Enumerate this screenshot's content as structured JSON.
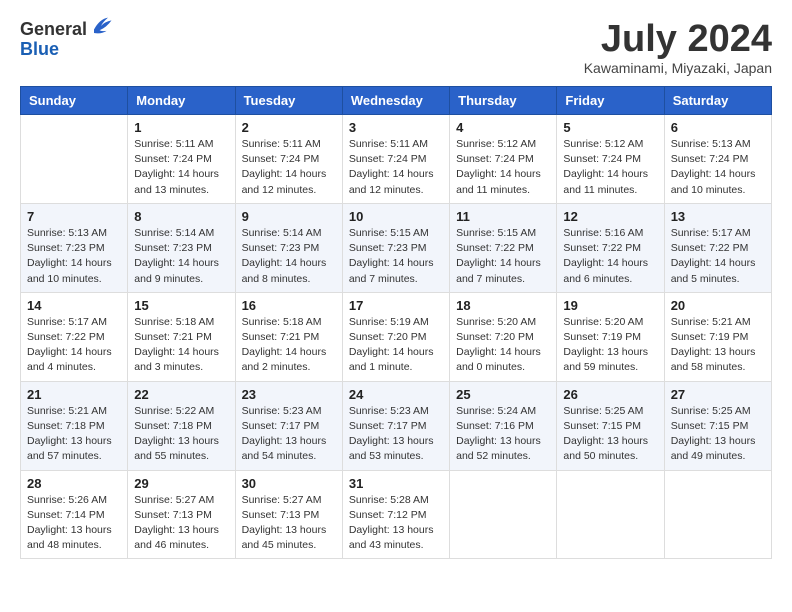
{
  "header": {
    "logo": {
      "general": "General",
      "blue": "Blue"
    },
    "title": "July 2024",
    "subtitle": "Kawaminami, Miyazaki, Japan"
  },
  "days_of_week": [
    "Sunday",
    "Monday",
    "Tuesday",
    "Wednesday",
    "Thursday",
    "Friday",
    "Saturday"
  ],
  "weeks": [
    [
      {
        "day": "",
        "info": ""
      },
      {
        "day": "1",
        "info": "Sunrise: 5:11 AM\nSunset: 7:24 PM\nDaylight: 14 hours\nand 13 minutes."
      },
      {
        "day": "2",
        "info": "Sunrise: 5:11 AM\nSunset: 7:24 PM\nDaylight: 14 hours\nand 12 minutes."
      },
      {
        "day": "3",
        "info": "Sunrise: 5:11 AM\nSunset: 7:24 PM\nDaylight: 14 hours\nand 12 minutes."
      },
      {
        "day": "4",
        "info": "Sunrise: 5:12 AM\nSunset: 7:24 PM\nDaylight: 14 hours\nand 11 minutes."
      },
      {
        "day": "5",
        "info": "Sunrise: 5:12 AM\nSunset: 7:24 PM\nDaylight: 14 hours\nand 11 minutes."
      },
      {
        "day": "6",
        "info": "Sunrise: 5:13 AM\nSunset: 7:24 PM\nDaylight: 14 hours\nand 10 minutes."
      }
    ],
    [
      {
        "day": "7",
        "info": "Sunrise: 5:13 AM\nSunset: 7:23 PM\nDaylight: 14 hours\nand 10 minutes."
      },
      {
        "day": "8",
        "info": "Sunrise: 5:14 AM\nSunset: 7:23 PM\nDaylight: 14 hours\nand 9 minutes."
      },
      {
        "day": "9",
        "info": "Sunrise: 5:14 AM\nSunset: 7:23 PM\nDaylight: 14 hours\nand 8 minutes."
      },
      {
        "day": "10",
        "info": "Sunrise: 5:15 AM\nSunset: 7:23 PM\nDaylight: 14 hours\nand 7 minutes."
      },
      {
        "day": "11",
        "info": "Sunrise: 5:15 AM\nSunset: 7:22 PM\nDaylight: 14 hours\nand 7 minutes."
      },
      {
        "day": "12",
        "info": "Sunrise: 5:16 AM\nSunset: 7:22 PM\nDaylight: 14 hours\nand 6 minutes."
      },
      {
        "day": "13",
        "info": "Sunrise: 5:17 AM\nSunset: 7:22 PM\nDaylight: 14 hours\nand 5 minutes."
      }
    ],
    [
      {
        "day": "14",
        "info": "Sunrise: 5:17 AM\nSunset: 7:22 PM\nDaylight: 14 hours\nand 4 minutes."
      },
      {
        "day": "15",
        "info": "Sunrise: 5:18 AM\nSunset: 7:21 PM\nDaylight: 14 hours\nand 3 minutes."
      },
      {
        "day": "16",
        "info": "Sunrise: 5:18 AM\nSunset: 7:21 PM\nDaylight: 14 hours\nand 2 minutes."
      },
      {
        "day": "17",
        "info": "Sunrise: 5:19 AM\nSunset: 7:20 PM\nDaylight: 14 hours\nand 1 minute."
      },
      {
        "day": "18",
        "info": "Sunrise: 5:20 AM\nSunset: 7:20 PM\nDaylight: 14 hours\nand 0 minutes."
      },
      {
        "day": "19",
        "info": "Sunrise: 5:20 AM\nSunset: 7:19 PM\nDaylight: 13 hours\nand 59 minutes."
      },
      {
        "day": "20",
        "info": "Sunrise: 5:21 AM\nSunset: 7:19 PM\nDaylight: 13 hours\nand 58 minutes."
      }
    ],
    [
      {
        "day": "21",
        "info": "Sunrise: 5:21 AM\nSunset: 7:18 PM\nDaylight: 13 hours\nand 57 minutes."
      },
      {
        "day": "22",
        "info": "Sunrise: 5:22 AM\nSunset: 7:18 PM\nDaylight: 13 hours\nand 55 minutes."
      },
      {
        "day": "23",
        "info": "Sunrise: 5:23 AM\nSunset: 7:17 PM\nDaylight: 13 hours\nand 54 minutes."
      },
      {
        "day": "24",
        "info": "Sunrise: 5:23 AM\nSunset: 7:17 PM\nDaylight: 13 hours\nand 53 minutes."
      },
      {
        "day": "25",
        "info": "Sunrise: 5:24 AM\nSunset: 7:16 PM\nDaylight: 13 hours\nand 52 minutes."
      },
      {
        "day": "26",
        "info": "Sunrise: 5:25 AM\nSunset: 7:15 PM\nDaylight: 13 hours\nand 50 minutes."
      },
      {
        "day": "27",
        "info": "Sunrise: 5:25 AM\nSunset: 7:15 PM\nDaylight: 13 hours\nand 49 minutes."
      }
    ],
    [
      {
        "day": "28",
        "info": "Sunrise: 5:26 AM\nSunset: 7:14 PM\nDaylight: 13 hours\nand 48 minutes."
      },
      {
        "day": "29",
        "info": "Sunrise: 5:27 AM\nSunset: 7:13 PM\nDaylight: 13 hours\nand 46 minutes."
      },
      {
        "day": "30",
        "info": "Sunrise: 5:27 AM\nSunset: 7:13 PM\nDaylight: 13 hours\nand 45 minutes."
      },
      {
        "day": "31",
        "info": "Sunrise: 5:28 AM\nSunset: 7:12 PM\nDaylight: 13 hours\nand 43 minutes."
      },
      {
        "day": "",
        "info": ""
      },
      {
        "day": "",
        "info": ""
      },
      {
        "day": "",
        "info": ""
      }
    ]
  ]
}
